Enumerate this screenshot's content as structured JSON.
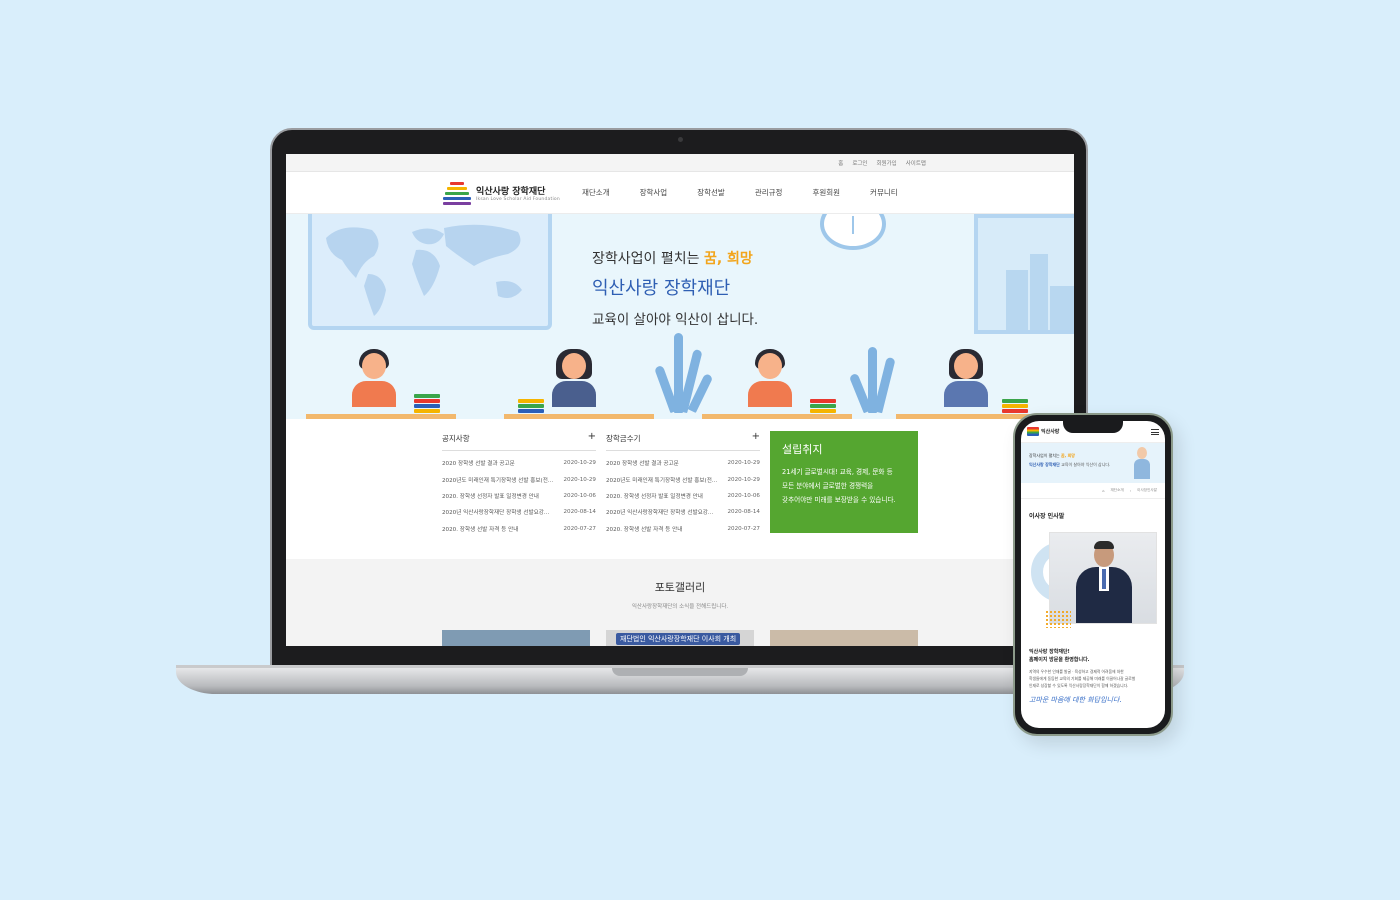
{
  "colors": {
    "background": "#d9eefb",
    "brand_green": "#55a630",
    "brand_blue": "#2f5fb3",
    "highlight_orange": "#f2a51c"
  },
  "site": {
    "util_links": [
      "홈",
      "로그인",
      "회원가입",
      "사이트맵"
    ],
    "logo_name": "익산사랑 장학재단",
    "logo_sub": "Iksan Love Scholar Aid Foundation",
    "nav": [
      "재단소개",
      "장학사업",
      "장학선발",
      "관리규정",
      "후원회원",
      "커뮤니티"
    ],
    "hero": {
      "line1_prefix": "장학사업이 펼치는 ",
      "line1_highlight": "꿈, 희망",
      "line2": "익산사랑 장학재단",
      "line3": "교육이 살아야 익산이 삽니다."
    },
    "notice": {
      "title": "공지사항",
      "more": "+",
      "items": [
        {
          "title": "2020 장학생 선발 결과 공고문",
          "date": "2020-10-29"
        },
        {
          "title": "2020년도 미래인재 특기장학생 선발 홍보(전...",
          "date": "2020-10-29"
        },
        {
          "title": "2020. 장학생 선정자 발표 일정변경 안내",
          "date": "2020-10-06"
        },
        {
          "title": "2020년 익산사랑장학재단 장학생 선발요강...",
          "date": "2020-08-14"
        },
        {
          "title": "2020. 장학생 선발 자격 등 안내",
          "date": "2020-07-27"
        }
      ]
    },
    "essay": {
      "title": "장학금수기",
      "more": "+",
      "items": [
        {
          "title": "2020 장학생 선발 결과 공고문",
          "date": "2020-10-29"
        },
        {
          "title": "2020년도 미래인재 특기장학생 선발 홍보(전...",
          "date": "2020-10-29"
        },
        {
          "title": "2020. 장학생 선정자 발표 일정변경 안내",
          "date": "2020-10-06"
        },
        {
          "title": "2020년 익산사랑장학재단 장학생 선발요강...",
          "date": "2020-08-14"
        },
        {
          "title": "2020. 장학생 선발 자격 등 안내",
          "date": "2020-07-27"
        }
      ]
    },
    "founding": {
      "title": "설립취지",
      "lines": [
        "21세기 글로벌시대! 교육, 경제, 문화 등",
        "모든 분야에서 글로벌한 경쟁력을",
        "갖추어야만 미래를 보장받을 수 있습니다."
      ]
    },
    "gallery": {
      "title": "포토갤러리",
      "subtitle": "익산사랑장학재단의 소식을 전해드립니다.",
      "captions": [
        "",
        "재단법인 익산사랑장학재단 이사회 개최",
        ""
      ]
    }
  },
  "mobile": {
    "logo_name": "익산사랑",
    "hero_line1_prefix": "장학사업이 펼치는 ",
    "hero_line1_highlight": "꿈, 희망",
    "hero_line2_name": "익산사랑 장학재단",
    "hero_line2_rest": " 교육이 살아야 익산이 삽니다.",
    "breadcrumb": [
      "재단소개",
      "이사장인사말"
    ],
    "page_title": "이사장 인사말",
    "greeting_title_1": "익산사랑 장학재단!",
    "greeting_title_2": "홈페이지 방문을 환영합니다.",
    "greeting_body": [
      "지역의 우수한 인재를 발굴 · 육성하고 경제적 어려움에 처한",
      "학생들에게 동등한 교육의 기회를 제공해 미래를 이끌어나갈 글로벌",
      "인재로 성장할 수 있도록 익산사랑장학재단이 함께 하겠습니다."
    ],
    "signature": "고마운 마음에 대한 화답입니다."
  }
}
